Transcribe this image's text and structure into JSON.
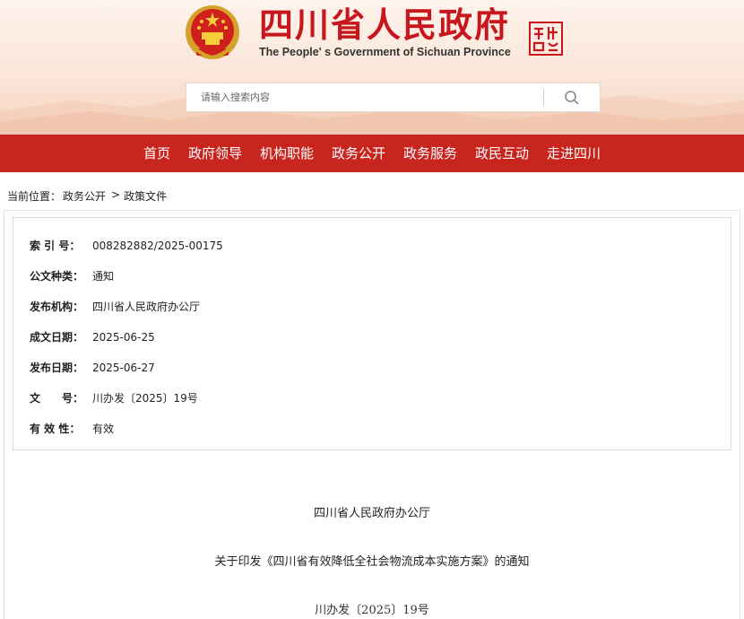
{
  "header": {
    "title": "四川省人民政府",
    "subtitle": "The People' s Government of Sichuan Province"
  },
  "search": {
    "placeholder": "请输入搜索内容"
  },
  "nav": {
    "items": [
      "首页",
      "政府领导",
      "机构职能",
      "政务公开",
      "政务服务",
      "政民互动",
      "走进四川"
    ]
  },
  "breadcrumb": {
    "label": "当前位置：",
    "items": [
      "政务公开",
      "政策文件"
    ],
    "separator": ">"
  },
  "meta": {
    "rows": [
      {
        "label": "索 引 号：",
        "value": "008282882/2025-00175"
      },
      {
        "label": "公文种类：",
        "value": "通知"
      },
      {
        "label": "发布机构：",
        "value": "四川省人民政府办公厅"
      },
      {
        "label": "成文日期：",
        "value": "2025-06-25"
      },
      {
        "label": "发布日期：",
        "value": "2025-06-27"
      },
      {
        "label": "文　　号：",
        "value": "川办发〔2025〕19号"
      },
      {
        "label": "有 效 性：",
        "value": "有效"
      }
    ]
  },
  "document": {
    "issuer": "四川省人民政府办公厅",
    "title": "关于印发《四川省有效降低全社会物流成本实施方案》的通知",
    "number": "川办发〔2025〕19号"
  },
  "colors": {
    "brand_red": "#c8161d",
    "nav_red": "#c9251f",
    "header_bg": "#fbe6d9"
  }
}
